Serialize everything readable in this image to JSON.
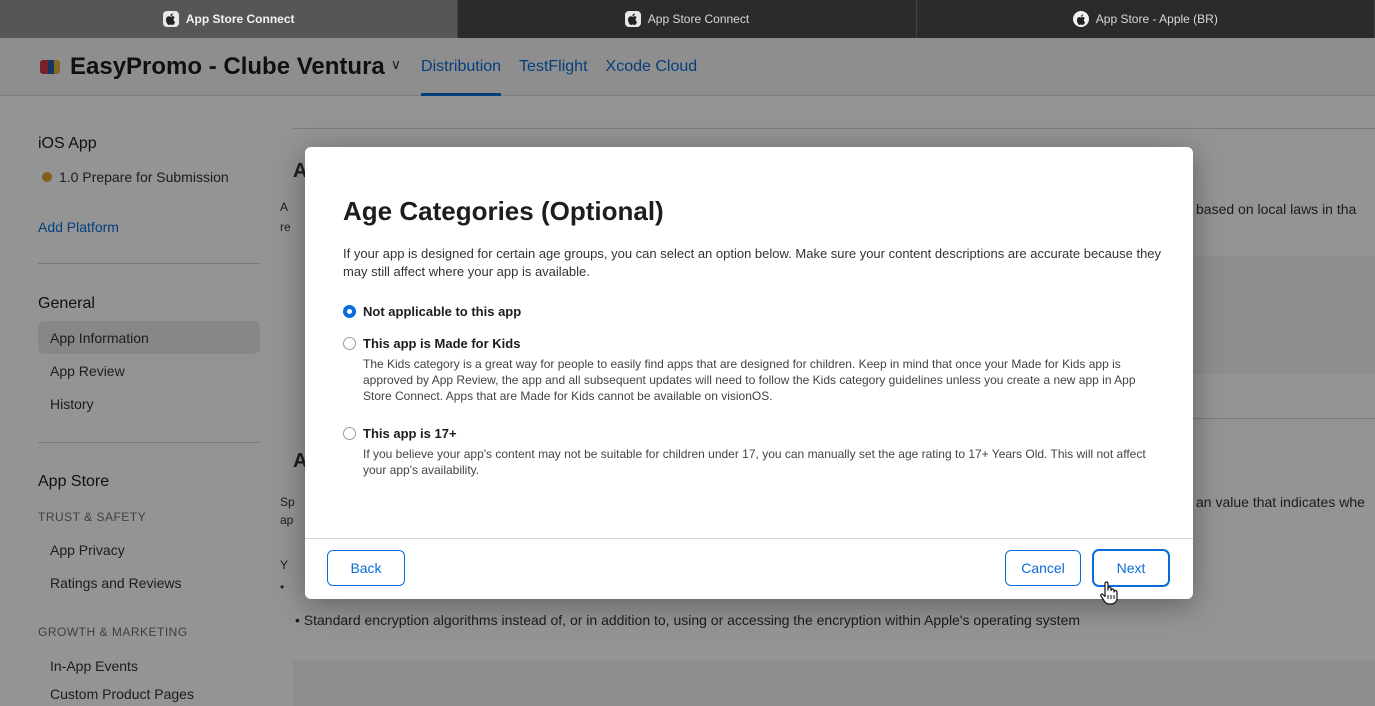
{
  "browser": {
    "tabs": [
      {
        "title": "App Store Connect",
        "icon": "apple-logo-icon",
        "active": true
      },
      {
        "title": "App Store Connect",
        "icon": "apple-logo-icon",
        "active": false
      },
      {
        "title": "App Store - Apple (BR)",
        "icon": "apple-circle-icon",
        "active": false
      }
    ]
  },
  "header": {
    "app_name": "EasyPromo - Clube Ventura",
    "chevron": "∨",
    "tabs": [
      "Distribution",
      "TestFlight",
      "Xcode Cloud"
    ],
    "active_tab": "Distribution"
  },
  "sidebar": {
    "platform_heading": "iOS App",
    "version_label": "1.0 Prepare for Submission",
    "add_platform": "Add Platform",
    "general_heading": "General",
    "general_items": [
      "App Information",
      "App Review",
      "History"
    ],
    "selected_item": "App Information",
    "appstore_heading": "App Store",
    "trust_heading": "TRUST & SAFETY",
    "trust_items": [
      "App Privacy",
      "Ratings and Reviews"
    ],
    "growth_heading": "GROWTH & MARKETING",
    "growth_items": [
      "In-App Events",
      "Custom Product Pages"
    ]
  },
  "main": {
    "section1_letter": "A",
    "section1_a": "A",
    "section1_re": "re",
    "section1_right": "based on local laws in tha",
    "section2_letter": "A",
    "section2_sp": "Sp",
    "section2_ap": "ap",
    "section2_right": "an value that indicates whe",
    "section2_y": "Y",
    "bullet_1": "•",
    "bullet_2": "•  Standard encryption algorithms instead of, or in addition to, using or accessing the encryption within Apple's operating system"
  },
  "modal": {
    "title": "Age Categories (Optional)",
    "description": "If your app is designed for certain age groups, you can select an option below. Make sure your content descriptions are accurate because they may still affect where your app is available.",
    "options": [
      {
        "label": "Not applicable to this app",
        "description": "",
        "selected": true
      },
      {
        "label": "This app is Made for Kids",
        "description": "The Kids category is a great way for people to easily find apps that are designed for children. Keep in mind that once your Made for Kids app is approved by App Review, the app and all subsequent updates will need to follow the Kids category guidelines unless you create a new app in App Store Connect. Apps that are Made for Kids cannot be available on visionOS.",
        "selected": false
      },
      {
        "label": "This app is 17+",
        "description": "If you believe your app's content may not be suitable for children under 17, you can manually set the age rating to 17+ Years Old. This will not affect your app's availability.",
        "selected": false
      }
    ],
    "back_label": "Back",
    "cancel_label": "Cancel",
    "next_label": "Next"
  },
  "colors": {
    "accent": "#0a6cd8",
    "status_pending": "#e2a330"
  }
}
